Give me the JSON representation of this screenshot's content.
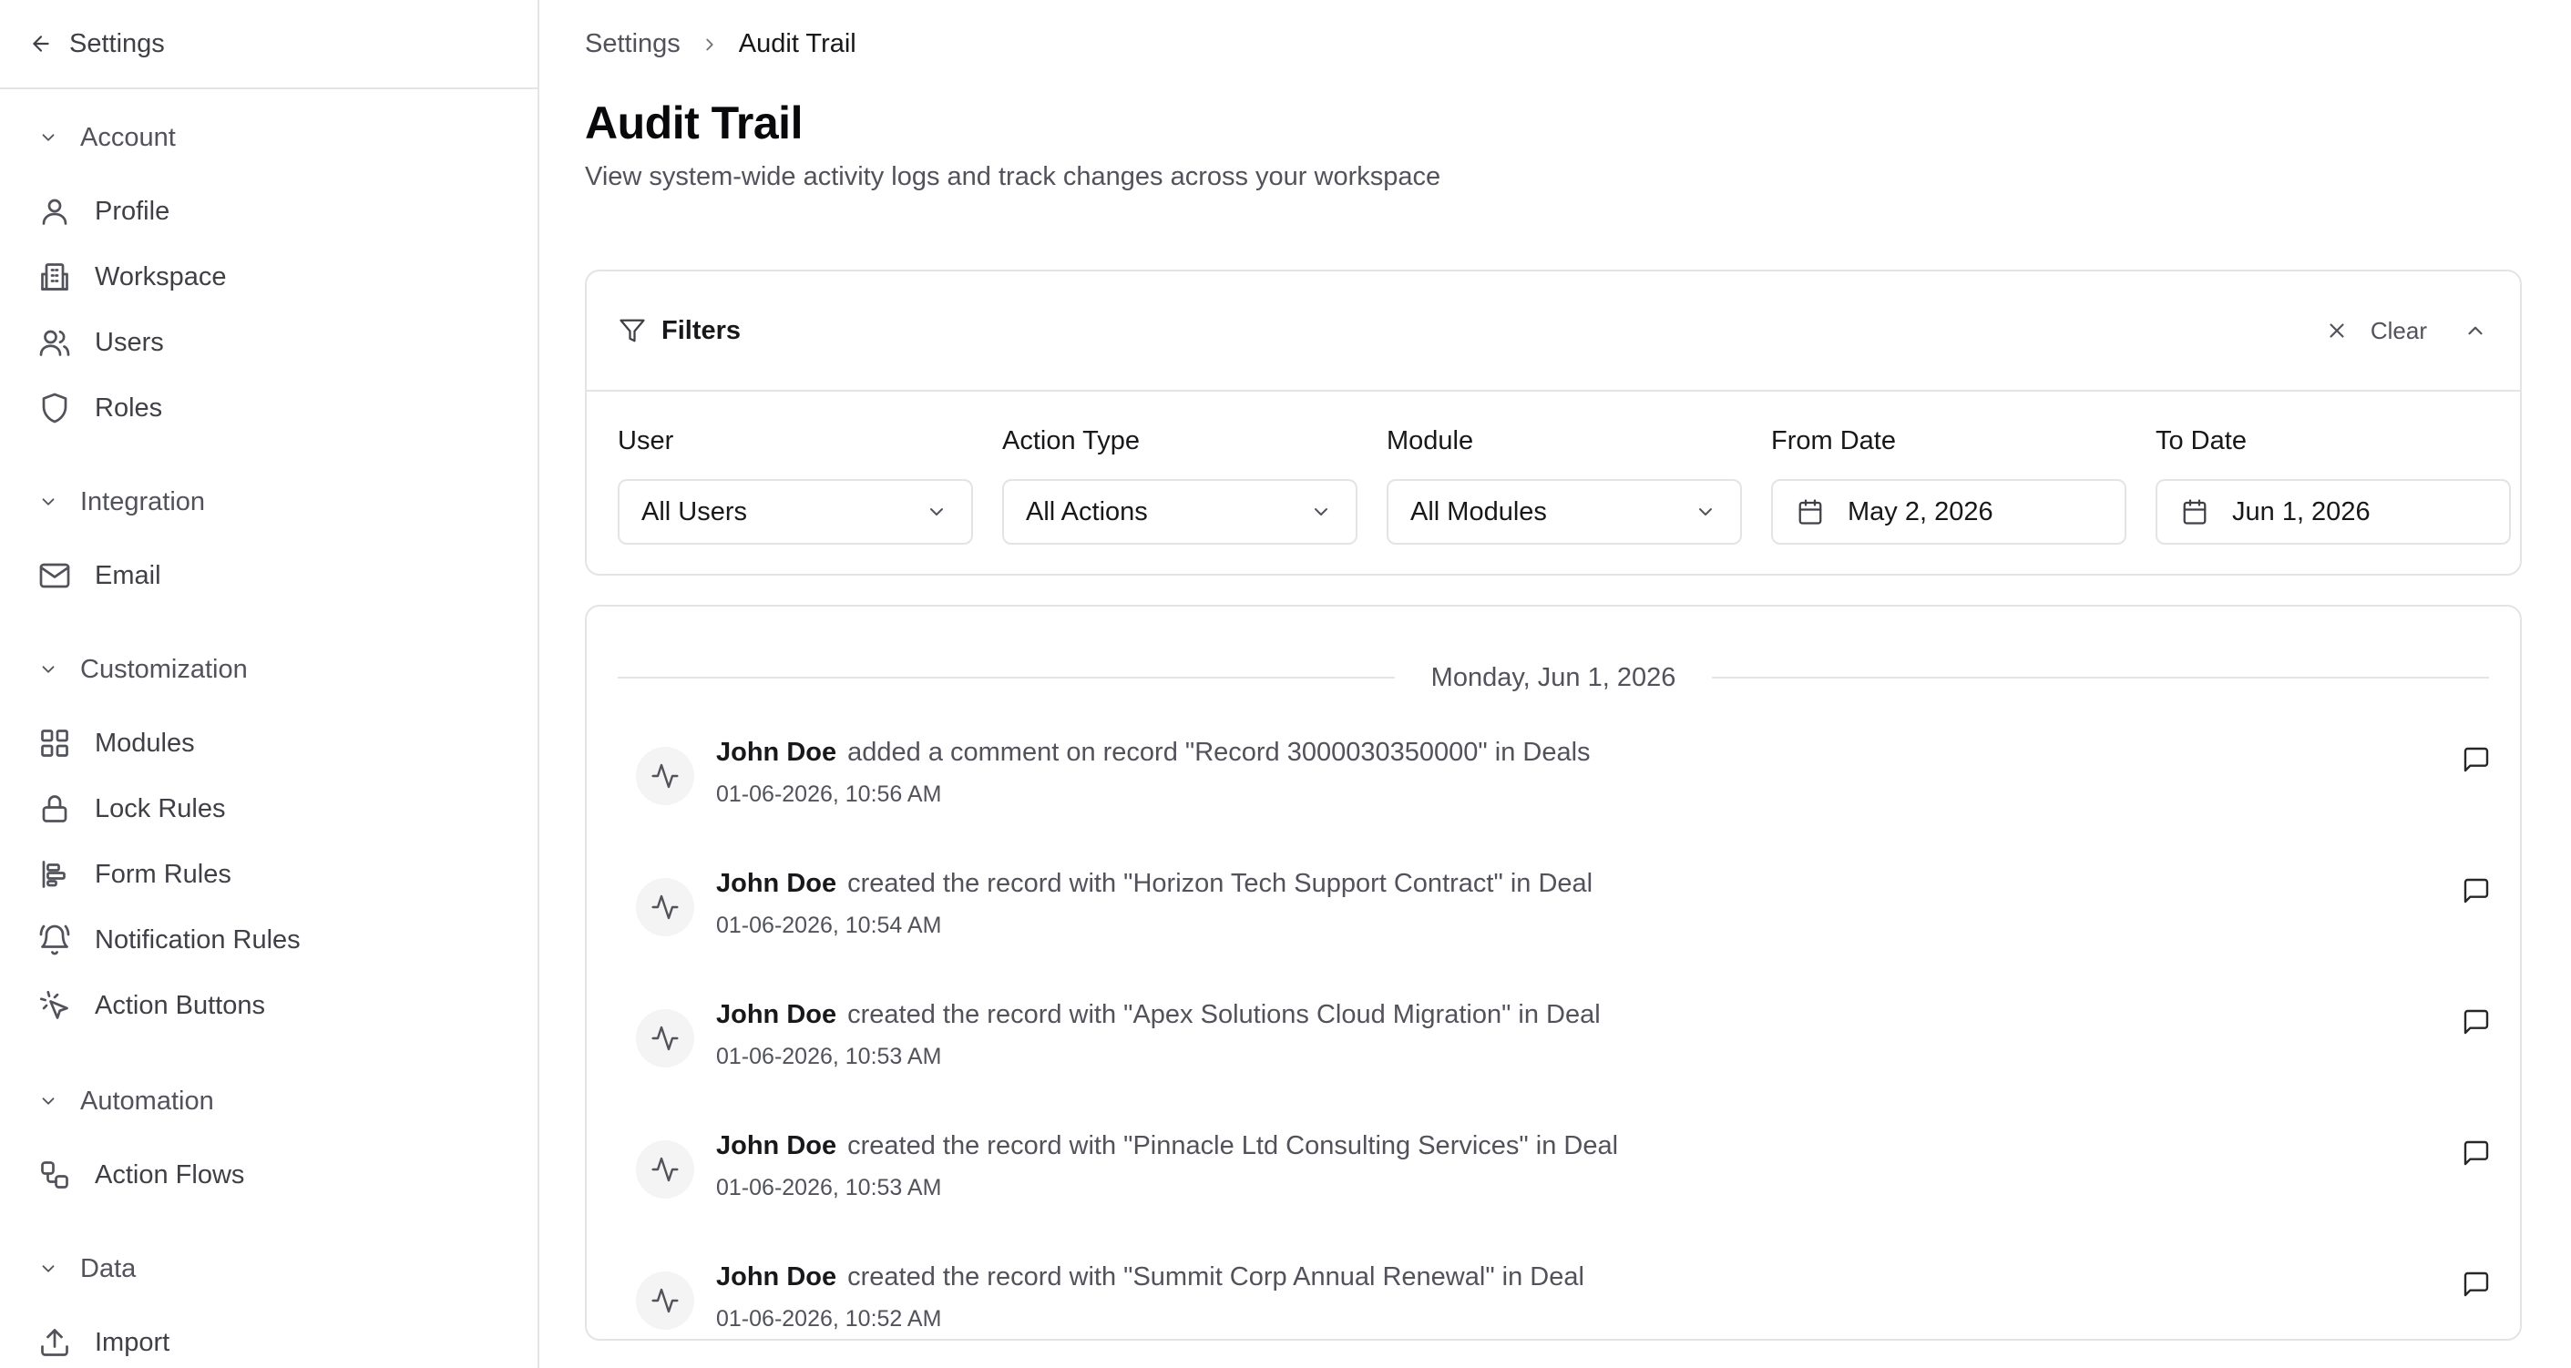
{
  "sidebar": {
    "title": "Settings",
    "groups": [
      {
        "label": "Account",
        "items": [
          {
            "label": "Profile"
          },
          {
            "label": "Workspace"
          },
          {
            "label": "Users"
          },
          {
            "label": "Roles"
          }
        ]
      },
      {
        "label": "Integration",
        "items": [
          {
            "label": "Email"
          }
        ]
      },
      {
        "label": "Customization",
        "items": [
          {
            "label": "Modules"
          },
          {
            "label": "Lock Rules"
          },
          {
            "label": "Form Rules"
          },
          {
            "label": "Notification Rules"
          },
          {
            "label": "Action Buttons"
          }
        ]
      },
      {
        "label": "Automation",
        "items": [
          {
            "label": "Action Flows"
          }
        ]
      },
      {
        "label": "Data",
        "items": [
          {
            "label": "Import"
          }
        ]
      }
    ]
  },
  "breadcrumb": {
    "parent": "Settings",
    "current": "Audit Trail"
  },
  "page": {
    "title": "Audit Trail",
    "description": "View system-wide activity logs and track changes across your workspace"
  },
  "filters": {
    "title": "Filters",
    "clear_label": "Clear",
    "fields": {
      "user": {
        "label": "User",
        "value": "All Users"
      },
      "action_type": {
        "label": "Action Type",
        "value": "All Actions"
      },
      "module": {
        "label": "Module",
        "value": "All Modules"
      },
      "from_date": {
        "label": "From Date",
        "value": "May 2, 2026"
      },
      "to_date": {
        "label": "To Date",
        "value": "Jun 1, 2026"
      }
    }
  },
  "log": {
    "date_label": "Monday, Jun 1, 2026",
    "entries": [
      {
        "user": "John Doe",
        "action": "added a comment on record \"Record 3000030350000\" in Deals",
        "timestamp": "01-06-2026, 10:56 AM"
      },
      {
        "user": "John Doe",
        "action": "created the record with \"Horizon Tech Support Contract\" in Deal",
        "timestamp": "01-06-2026, 10:54 AM"
      },
      {
        "user": "John Doe",
        "action": "created the record with \"Apex Solutions Cloud Migration\" in Deal",
        "timestamp": "01-06-2026, 10:53 AM"
      },
      {
        "user": "John Doe",
        "action": "created the record with \"Pinnacle Ltd Consulting Services\" in Deal",
        "timestamp": "01-06-2026, 10:53 AM"
      },
      {
        "user": "John Doe",
        "action": "created the record with \"Summit Corp Annual Renewal\" in Deal",
        "timestamp": "01-06-2026, 10:52 AM"
      }
    ]
  }
}
